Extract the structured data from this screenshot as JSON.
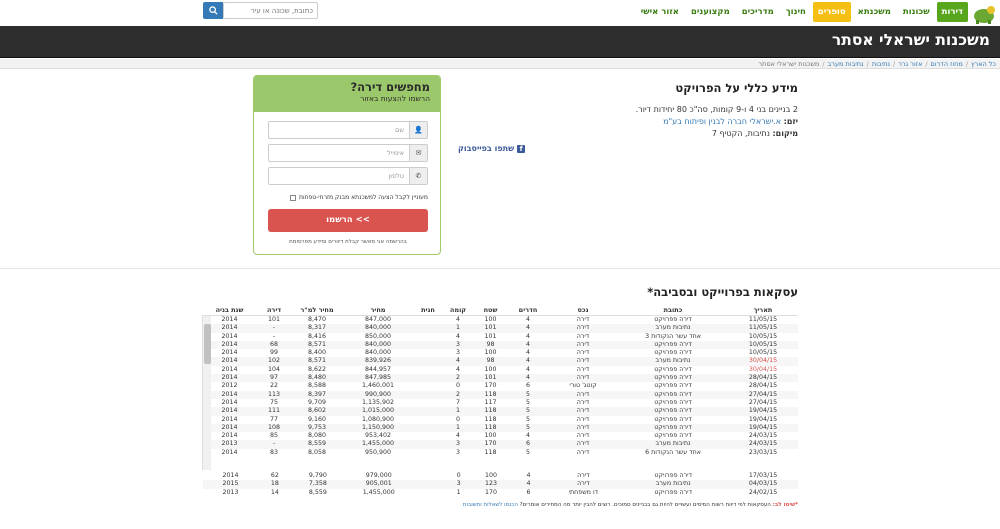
{
  "nav": {
    "items": [
      "דירות",
      "שכונות",
      "משכנתא",
      "סופרים",
      "חינוך",
      "מדריכים",
      "מקצוענים",
      "אזור אישי"
    ],
    "search_placeholder": "כתובת, שכונה או עיר"
  },
  "header": {
    "title": "משכנות ישראלי אסתר"
  },
  "breadcrumb": [
    "כל הארץ",
    "מחוז הדרום",
    "אזור גרר",
    "נתיבות",
    "נתיבות מערב",
    "משכנות ישראלי אסתר"
  ],
  "info": {
    "title": "מידע כללי על הפרויקט",
    "description": "2 בניינים בני 4 ו-9 קומות, סה\"כ 80 יחידות דיור.",
    "developer_label": "יזם:",
    "developer": "א.ישראלי חברה לבנין ופיתוח בע\"מ",
    "location_label": "מיקום:",
    "location": "נתיבות, הקטיף 7",
    "facebook": "שתפו בפייסבוק"
  },
  "form": {
    "title": "מחפשים דירה?",
    "subtitle": "הרשמו להצעות באזור",
    "name_placeholder": "שם",
    "email_placeholder": "אימייל",
    "phone_placeholder": "טלפון",
    "checkbox_label": "מעוניין לקבל הצעה למשכנתא מבנק מזרחי-טפחות",
    "submit": "הרשמו <<",
    "terms": "בהרשמה אני מאשר קבלת דיוורים ומידע מפרסומת"
  },
  "transactions": {
    "title": "עסקאות בפרוייקט ובסביבה*",
    "headers": [
      "תאריך",
      "כתובת",
      "נכס",
      "חדרים",
      "שטח",
      "קומה",
      "חנית",
      "מחיר",
      "מחיר למ\"ר",
      "דירה",
      "שנת בניה"
    ],
    "rows": [
      [
        "11/05/15",
        "דירה פפרויקט",
        "דירה",
        "4",
        "100",
        "4",
        "",
        "847,000",
        "8,470",
        "101",
        "2014"
      ],
      [
        "11/05/15",
        "נתיבות מערב",
        "דירה",
        "4",
        "101",
        "1",
        "",
        "840,000",
        "8,317",
        "-",
        "2014"
      ],
      [
        "10/05/15",
        "אחד עשר הנקודות 3",
        "דירה",
        "4",
        "101",
        "4",
        "",
        "850,000",
        "8,416",
        "-",
        "2014"
      ],
      [
        "10/05/15",
        "דירה פפרויקט",
        "דירה",
        "4",
        "98",
        "3",
        "",
        "840,000",
        "8,571",
        "68",
        "2014"
      ],
      [
        "10/05/15",
        "דירה פפרויקט",
        "דירה",
        "4",
        "100",
        "3",
        "",
        "840,000",
        "8,400",
        "99",
        "2014"
      ],
      [
        "30/04/15",
        "נתיבות מערב",
        "דירה",
        "4",
        "98",
        "4",
        "",
        "839,926",
        "8,571",
        "102",
        "2014"
      ],
      [
        "30/04/15",
        "דירה פפרויקט",
        "דירה",
        "4",
        "100",
        "4",
        "",
        "844,957",
        "8,622",
        "104",
        "2014"
      ],
      [
        "28/04/15",
        "דירה פפרויקט",
        "דירה",
        "4",
        "101",
        "2",
        "",
        "847,985",
        "8,480",
        "97",
        "2014"
      ],
      [
        "28/04/15",
        "דירה פפרויקט",
        "קוטג' טורי",
        "6",
        "170",
        "0",
        "",
        "1,460,001",
        "8,588",
        "22",
        "2012"
      ],
      [
        "27/04/15",
        "דירה פפרויקט",
        "דירה",
        "5",
        "118",
        "2",
        "",
        "990,900",
        "8,397",
        "113",
        "2014"
      ],
      [
        "27/04/15",
        "דירה פפרויקט",
        "דירה",
        "5",
        "117",
        "7",
        "",
        "1,135,902",
        "9,709",
        "75",
        "2014"
      ],
      [
        "19/04/15",
        "דירה פפרויקט",
        "דירה",
        "5",
        "118",
        "1",
        "",
        "1,015,000",
        "8,602",
        "111",
        "2014"
      ],
      [
        "19/04/15",
        "דירה פפרויקט",
        "דירה",
        "5",
        "118",
        "0",
        "",
        "1,080,900",
        "9,160",
        "77",
        "2014"
      ],
      [
        "19/04/15",
        "דירה פפרויקט",
        "דירה",
        "5",
        "118",
        "1",
        "",
        "1,150,900",
        "9,753",
        "108",
        "2014"
      ],
      [
        "24/03/15",
        "דירה פפרויקט",
        "דירה",
        "4",
        "100",
        "4",
        "",
        "953,402",
        "8,080",
        "85",
        "2014"
      ],
      [
        "24/03/15",
        "נתיבות מערב",
        "דירה",
        "6",
        "170",
        "3",
        "",
        "1,455,000",
        "8,559",
        "-",
        "2013"
      ],
      [
        "23/03/15",
        "אחד עשר הנקודות 6",
        "דירה",
        "5",
        "118",
        "3",
        "",
        "950,900",
        "8,058",
        "83",
        "2014"
      ]
    ],
    "overlay_rows": [
      [
        "17/03/15",
        "דירה פפרויקט",
        "דירה",
        "4",
        "100",
        "0",
        "",
        "979,000",
        "9,790",
        "62",
        "2014"
      ],
      [
        "04/03/15",
        "נתיבות מערב",
        "דירה",
        "4",
        "123",
        "3",
        "",
        "905,001",
        "7,358",
        "18",
        "2015"
      ],
      [
        "24/02/15",
        "דירה פפרויקט",
        "דו משפחתי",
        "6",
        "170",
        "1",
        "",
        "1,455,000",
        "8,559",
        "14",
        "2013"
      ]
    ],
    "red_dates": [
      "30/04/15"
    ],
    "note_label": "*שימו לב:",
    "note": "העסקאות לפי דיווח רשות המיסים ועשויים להיות גם בבניינים סמוכים. רוצים להבין יותר מה המחירים אומרים?",
    "note_link": "הכנסו לשאלות ותשובות"
  },
  "colors": {
    "accent": "#58a51e",
    "header": "#2d2d2d",
    "button": "#d9534f",
    "form_head": "#9bc86a"
  }
}
